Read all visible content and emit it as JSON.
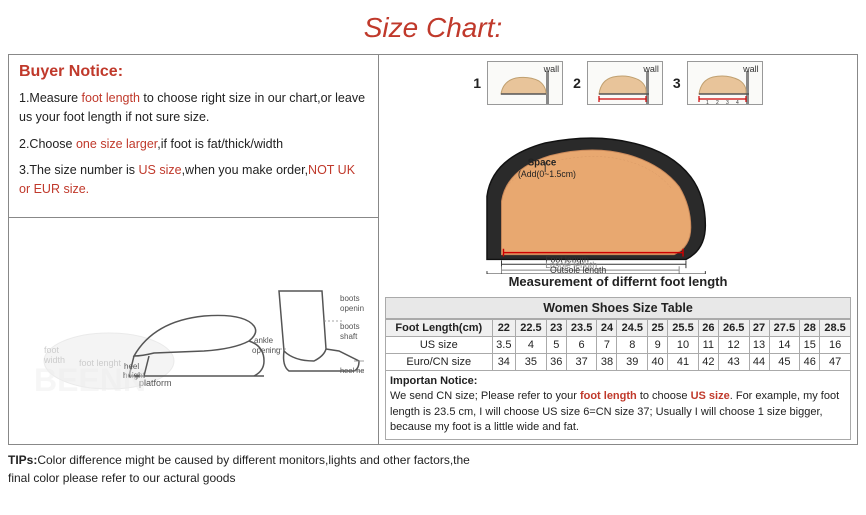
{
  "title": "Size Chart:",
  "buyer_notice": {
    "heading": "Buyer Notice:",
    "points": [
      {
        "id": 1,
        "text_before": "1.Measure ",
        "highlight1": "foot length",
        "text_after": " to choose right size in our chart,or leave us your foot length if not sure size."
      },
      {
        "id": 2,
        "text_before": "2.Choose ",
        "highlight1": "one size larger",
        "text_after": ",if foot is fat/thick/width"
      },
      {
        "id": 3,
        "text_before": "3.The size number is ",
        "highlight1": "US size",
        "text_middle": ",when you make order,",
        "highlight2": "NOT UK or EUR size.",
        "text_after": ""
      }
    ]
  },
  "measurement_title": "Measurement of differnt foot length",
  "size_table": {
    "title": "Women Shoes Size Table",
    "headers": [
      "Foot Length(cm)",
      "22",
      "22.5",
      "23",
      "23.5",
      "24",
      "24.5",
      "25",
      "25.5",
      "26",
      "26.5",
      "27",
      "27.5",
      "28",
      "28.5"
    ],
    "rows": [
      {
        "label": "US size",
        "values": [
          "3.5",
          "4",
          "5",
          "6",
          "7",
          "8",
          "9",
          "10",
          "11",
          "12",
          "13",
          "14",
          "15",
          "16"
        ]
      },
      {
        "label": "Euro/CN size",
        "values": [
          "34",
          "35",
          "36",
          "37",
          "38",
          "39",
          "40",
          "41",
          "42",
          "43",
          "44",
          "45",
          "46",
          "47"
        ]
      }
    ]
  },
  "important_notice": {
    "label": "Importan Notice:",
    "text": "We send CN size; Please refer to your foot length to choose US size. For example, my foot length is 23.5 cm, I will choose US size 6=CN size 37; Usually I will choose 1 size bigger, because my foot is a little wide and fat."
  },
  "tips": {
    "label": "TIPs:",
    "text": "Color difference might be caused by different monitors,lights and other factors,the final color please refer to our actural goods"
  },
  "steps": [
    {
      "num": "1",
      "wall": "wall"
    },
    {
      "num": "2",
      "wall": "wall"
    },
    {
      "num": "3",
      "wall": "wall"
    }
  ],
  "diagram_labels": {
    "space": "Space",
    "space_sub": "(Add(0~1.5cm)",
    "foot_length": "Foot length",
    "insole_length": "Lnsole length",
    "outsole_length": "Outsole length"
  },
  "shoe_labels": {
    "foot_width": "foot width",
    "foot_length": "foot lenght",
    "platform": "platform",
    "boots_opening": "boots opening",
    "boots_shaft": "boots shaft",
    "ankle_opening": "ankle opening",
    "heel_height": "heel height",
    "heel_height2": "heel height"
  },
  "and_text": "and"
}
